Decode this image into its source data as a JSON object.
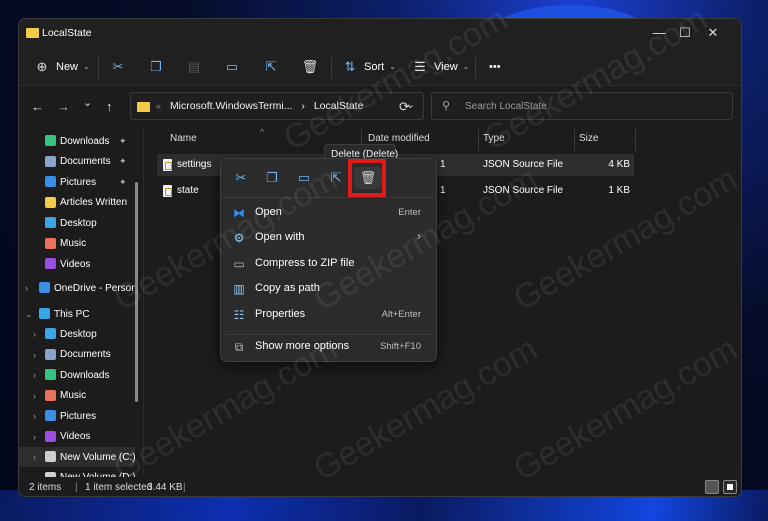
{
  "window": {
    "title": "LocalState",
    "controls": {
      "minimize": "—",
      "maximize": "☐",
      "close": "✕"
    }
  },
  "toolbar": {
    "new_label": "New",
    "sort_label": "Sort",
    "view_label": "View",
    "more_label": "•••",
    "icons": [
      "cut-icon",
      "copy-icon",
      "paste-icon",
      "rename-icon",
      "share-icon",
      "delete-icon"
    ]
  },
  "navigation": {
    "back": "←",
    "forward": "→",
    "recent": "⌄",
    "up": "↑",
    "path_overflow": "«",
    "path_parent": "Microsoft.WindowsTermi...",
    "path_sep": "›",
    "path_current": "LocalState",
    "refresh": "⟳",
    "search_placeholder": "Search LocalState"
  },
  "sidebar": {
    "quick_access": [
      {
        "label": "Downloads",
        "pinned": true,
        "color": "#33c481"
      },
      {
        "label": "Documents",
        "pinned": true,
        "color": "#8aa3c8"
      },
      {
        "label": "Pictures",
        "pinned": true,
        "color": "#3a8ee6"
      },
      {
        "label": "Articles Written",
        "pinned": false,
        "color": "#f5c94a"
      },
      {
        "label": "Desktop",
        "pinned": false,
        "color": "#39a6e6"
      },
      {
        "label": "Music",
        "pinned": false,
        "color": "#e8735a"
      },
      {
        "label": "Videos",
        "pinned": false,
        "color": "#9b4de0"
      }
    ],
    "onedrive": "OneDrive - Person",
    "this_pc": "This PC",
    "pc_items": [
      {
        "label": "Desktop",
        "color": "#39a6e6"
      },
      {
        "label": "Documents",
        "color": "#8aa3c8"
      },
      {
        "label": "Downloads",
        "color": "#33c481"
      },
      {
        "label": "Music",
        "color": "#e8735a"
      },
      {
        "label": "Pictures",
        "color": "#3a8ee6"
      },
      {
        "label": "Videos",
        "color": "#9b4de0"
      },
      {
        "label": "New Volume (C:)",
        "color": "#cfcfcf"
      },
      {
        "label": "New Volume (D:)",
        "color": "#cfcfcf"
      }
    ],
    "pin_glyph": "📌"
  },
  "columns": {
    "name": "Name",
    "date": "Date modified",
    "type": "Type",
    "size": "Size"
  },
  "files": [
    {
      "name": "settings",
      "date": "1",
      "type": "JSON Source File",
      "size": "4 KB",
      "selected": true
    },
    {
      "name": "state",
      "date": "1",
      "type": "JSON Source File",
      "size": "1 KB",
      "selected": false
    }
  ],
  "context_menu": {
    "tooltip": "Delete (Delete)",
    "quick_icons": [
      "cut",
      "copy",
      "rename",
      "share",
      "delete"
    ],
    "items": [
      {
        "label": "Open",
        "shortcut": "Enter"
      },
      {
        "label": "Open with",
        "shortcut": "›"
      },
      {
        "label": "Compress to ZIP file",
        "shortcut": ""
      },
      {
        "label": "Copy as path",
        "shortcut": ""
      },
      {
        "label": "Properties",
        "shortcut": "Alt+Enter"
      },
      {
        "label": "Show more options",
        "shortcut": "Shift+F10"
      }
    ]
  },
  "status": {
    "items": "2 items",
    "sep": "|",
    "selected": "1 item selected",
    "size": "3.44 KB"
  },
  "watermark": "Geekermag.com"
}
